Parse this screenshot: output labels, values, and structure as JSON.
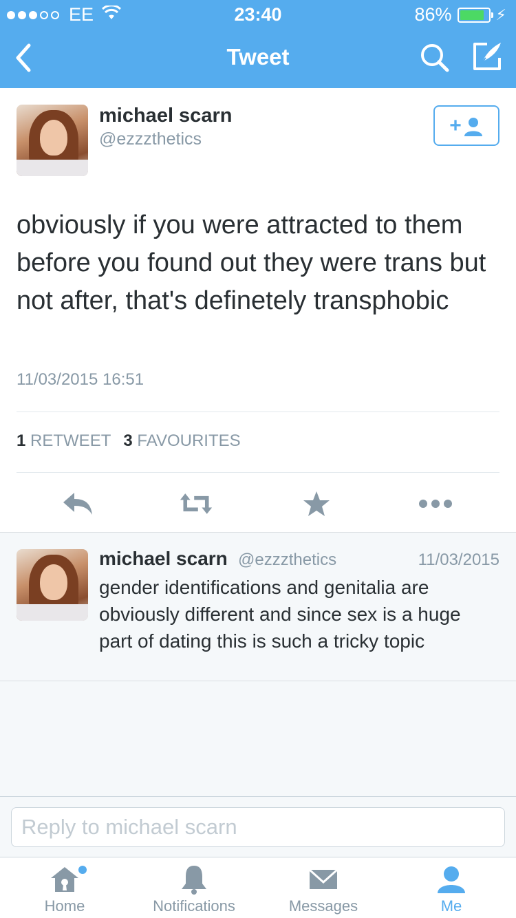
{
  "status_bar": {
    "carrier": "EE",
    "time": "23:40",
    "battery_percent": "86%",
    "battery_level": 0.86,
    "signal_bars_filled": 3,
    "signal_bars_total": 5
  },
  "nav": {
    "title": "Tweet",
    "back_icon": "chevron-left-icon",
    "search_icon": "search-icon",
    "compose_icon": "compose-icon"
  },
  "tweet": {
    "author_name": "michael scarn",
    "author_handle": "@ezzzthetics",
    "follow_icon": "follow-user-icon",
    "follow_label": "+",
    "text": "obviously if you were attracted to them before you found out they were trans but not after, that's definetely transphobic",
    "timestamp": "11/03/2015 16:51",
    "retweet_count": "1",
    "retweet_label": "RETWEET",
    "favourite_count": "3",
    "favourite_label": "FAVOURITES"
  },
  "reply": {
    "author_name": "michael scarn",
    "author_handle": "@ezzzthetics",
    "date": "11/03/2015",
    "text": "gender identifications and genitalia are obviously different and since sex is a huge part of dating this is such a tricky topic"
  },
  "reply_bar": {
    "placeholder": "Reply to michael scarn"
  },
  "tabs": [
    {
      "label": "Home",
      "icon": "home-icon",
      "has_badge": true
    },
    {
      "label": "Notifications",
      "icon": "bell-icon"
    },
    {
      "label": "Messages",
      "icon": "envelope-icon"
    },
    {
      "label": "Me",
      "icon": "person-icon",
      "active": true
    }
  ],
  "colors": {
    "brand_blue": "#55acee",
    "text_dark": "#292f33",
    "text_gray": "#8899a6",
    "background": "#f5f8fa",
    "battery_green": "#4cd964"
  }
}
